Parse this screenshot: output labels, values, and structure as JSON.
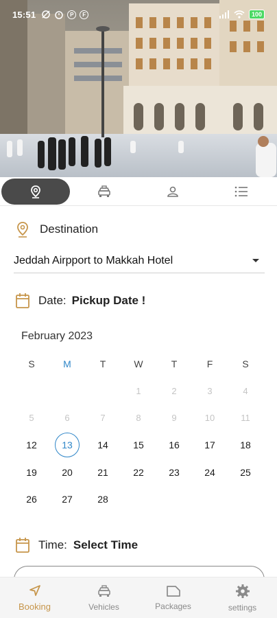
{
  "status_bar": {
    "time": "15:51",
    "battery": "100"
  },
  "steps": [
    {
      "icon": "location-pin-icon",
      "active": true
    },
    {
      "icon": "taxi-icon",
      "active": false
    },
    {
      "icon": "person-icon",
      "active": false
    },
    {
      "icon": "list-icon",
      "active": false
    }
  ],
  "destination": {
    "label": "Destination",
    "selected_value": "Jeddah Airpport to Makkah Hotel"
  },
  "date": {
    "label": "Date:",
    "value": "Pickup Date !"
  },
  "calendar": {
    "month_label": "February 2023",
    "weekdays": [
      "S",
      "M",
      "T",
      "W",
      "T",
      "F",
      "S"
    ],
    "today_weekday_index": 1,
    "weeks": [
      [
        null,
        null,
        null,
        "1",
        "2",
        "3",
        "4"
      ],
      [
        "5",
        "6",
        "7",
        "8",
        "9",
        "10",
        "11"
      ],
      [
        "12",
        "13",
        "14",
        "15",
        "16",
        "17",
        "18"
      ],
      [
        "19",
        "20",
        "21",
        "22",
        "23",
        "24",
        "25"
      ],
      [
        "26",
        "27",
        "28",
        null,
        null,
        null,
        null
      ]
    ],
    "selected_day": "13",
    "disabled_until_day": 12
  },
  "time": {
    "label": "Time:",
    "value": "Select Time"
  },
  "bottom_nav": [
    {
      "label": "Booking",
      "icon": "navigation-arrow-icon",
      "active": true
    },
    {
      "label": "Vehicles",
      "icon": "taxi-icon",
      "active": false
    },
    {
      "label": "Packages",
      "icon": "folder-icon",
      "active": false
    },
    {
      "label": "settings",
      "icon": "gear-icon",
      "active": false
    }
  ],
  "colors": {
    "accent": "#c6954a",
    "today": "#2f86c8",
    "active_tab": "#4a4a4a"
  }
}
